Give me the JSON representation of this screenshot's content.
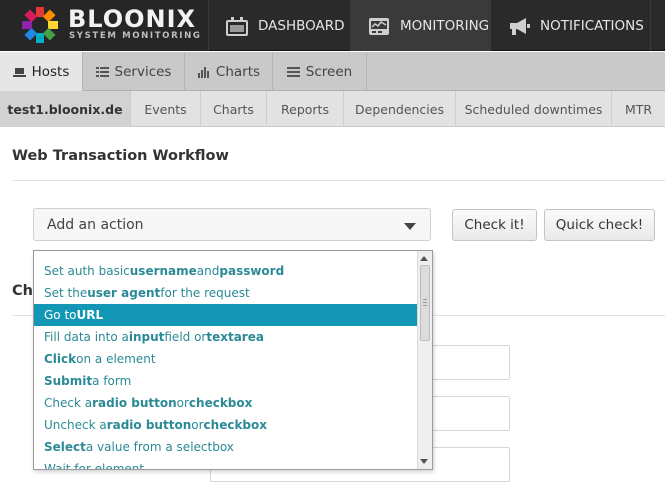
{
  "brand": {
    "title": "BLOONIX",
    "subtitle": "SYSTEM MONITORING"
  },
  "topnav": {
    "dashboard": "DASHBOARD",
    "monitoring": "MONITORING",
    "notifications": "NOTIFICATIONS"
  },
  "tabs": [
    {
      "label": "Hosts",
      "icon": "laptop-icon",
      "active": true
    },
    {
      "label": "Services",
      "icon": "list-icon",
      "active": false
    },
    {
      "label": "Charts",
      "icon": "bar-chart-icon",
      "active": false
    },
    {
      "label": "Screen",
      "icon": "screen-list-icon",
      "active": false
    }
  ],
  "subtabs": [
    {
      "label": "test1.bloonix.de",
      "active": true
    },
    {
      "label": "Events"
    },
    {
      "label": "Charts"
    },
    {
      "label": "Reports"
    },
    {
      "label": "Dependencies"
    },
    {
      "label": "Scheduled downtimes"
    },
    {
      "label": "MTR"
    }
  ],
  "page": {
    "title": "Web Transaction Workflow",
    "section_head_partial": "Ch"
  },
  "action_select": {
    "value": "Add an action"
  },
  "buttons": {
    "check": "Check it!",
    "quick_check": "Quick check!"
  },
  "dropdown": {
    "items": [
      {
        "parts": [
          "Set auth basic ",
          "username",
          " and ",
          "password"
        ],
        "selected": false
      },
      {
        "parts": [
          "Set the ",
          "user agent",
          " for the request"
        ],
        "selected": false
      },
      {
        "parts": [
          "Go to ",
          "URL"
        ],
        "selected": true
      },
      {
        "parts": [
          "Fill data into a ",
          "input",
          " field or ",
          "textarea"
        ],
        "selected": false
      },
      {
        "parts": [
          "",
          "Click",
          " on a element"
        ],
        "selected": false
      },
      {
        "parts": [
          "",
          "Submit",
          " a form"
        ],
        "selected": false
      },
      {
        "parts": [
          "Check a ",
          "radio button",
          " or ",
          "checkbox"
        ],
        "selected": false
      },
      {
        "parts": [
          "Uncheck a ",
          "radio button",
          " or ",
          "checkbox"
        ],
        "selected": false
      },
      {
        "parts": [
          "",
          "Select",
          " a value from a selectbox"
        ],
        "selected": false
      },
      {
        "parts": [
          "Wait for element"
        ],
        "selected": false
      }
    ]
  },
  "colors": {
    "topbar": "#2a2a2a",
    "accent": "#1497b5",
    "link_text": "#2b8a96"
  }
}
